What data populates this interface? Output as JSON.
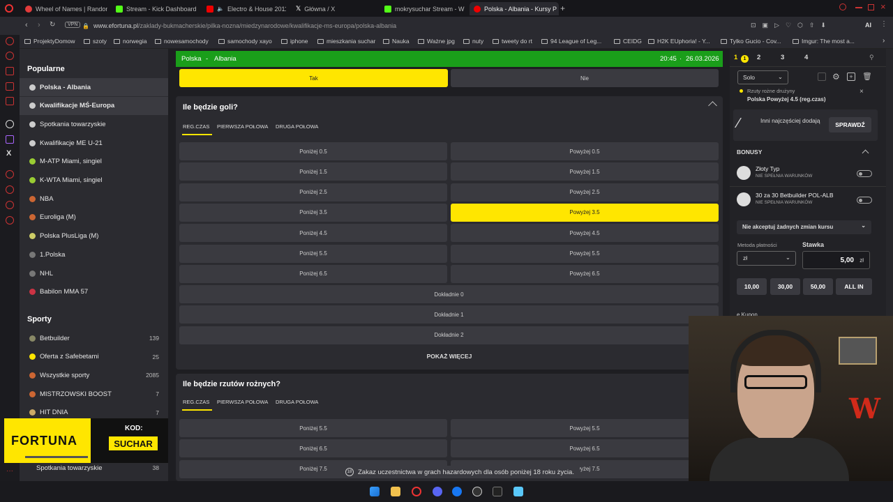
{
  "tabs": [
    {
      "label": "Wheel of Names | Random",
      "color": "#e23b3b"
    },
    {
      "label": "Stream - Kick Dashboard",
      "color": "#53fc18"
    },
    {
      "label": "Electro & House 2011",
      "color": "#e00"
    },
    {
      "label": "Główna / X",
      "color": "#fff"
    },
    {
      "label": "mokrysuchar Stream - W",
      "color": "#53fc18"
    },
    {
      "label": "Polska - Albania - Kursy P",
      "color": "#e00"
    }
  ],
  "address": {
    "vpn": "VPN",
    "host": "www.efortuna.pl",
    "path": "/zaklady-bukmacherskie/pilka-nozna/miedzynarodowe/kwalifikacje-ms-europa/polska-albania",
    "ai": "AI"
  },
  "bookmarks": [
    "ProjektyDomow",
    "szoty",
    "norwegia",
    "nowesamochody",
    "samochody xayo",
    "iphone",
    "mieszkania suchar",
    "Nauka",
    "Ważne jpg",
    "nuty",
    "tweety do rt",
    "94 League of Leg...",
    "CEIDG",
    "H2K EUphoria! - Y...",
    "Tylko Gucio - Cov...",
    "Imgur: The most a..."
  ],
  "sidebar": {
    "popular_title": "Popularne",
    "popular": [
      {
        "label": "Polska - Albania",
        "icon": "#ccc"
      },
      {
        "label": "Kwalifikacje MŚ-Europa",
        "icon": "#ccc"
      },
      {
        "label": "Spotkania towarzyskie",
        "icon": "#ccc"
      },
      {
        "label": "Kwalifikacje ME U-21",
        "icon": "#ccc"
      },
      {
        "label": "M-ATP Miami, singiel",
        "icon": "#9c3"
      },
      {
        "label": "K-WTA Miami, singiel",
        "icon": "#9c3"
      },
      {
        "label": "NBA",
        "icon": "#c63"
      },
      {
        "label": "Euroliga (M)",
        "icon": "#c63"
      },
      {
        "label": "Polska PlusLiga (M)",
        "icon": "#cc6"
      },
      {
        "label": "1.Polska",
        "icon": "#777"
      },
      {
        "label": "NHL",
        "icon": "#777"
      },
      {
        "label": "Babilon MMA 57",
        "icon": "#c34"
      }
    ],
    "sports_title": "Sporty",
    "sports": [
      {
        "label": "Betbuilder",
        "count": "139",
        "icon": "#886"
      },
      {
        "label": "Oferta z Safebetami",
        "count": "25",
        "icon": "#ffe600"
      },
      {
        "label": "Wszystkie sporty",
        "count": "2085",
        "icon": "#c63"
      },
      {
        "label": "MISTRZOWSKI BOOST",
        "count": "7",
        "icon": "#c63"
      },
      {
        "label": "HIT DNIA",
        "count": "7",
        "icon": "#ca6"
      }
    ],
    "bottom": {
      "label": "Spotkania towarzyskie",
      "count": "38"
    }
  },
  "match": {
    "home": "Polska",
    "sep": "-",
    "away": "Albania",
    "time": "20:45",
    "date": "26.03.2026",
    "yes": "Tak",
    "no": "Nie"
  },
  "goals": {
    "title": "Ile będzie goli?",
    "tabs": [
      "REG.CZAS",
      "PIERWSZA POŁOWA",
      "DRUGA POŁOWA"
    ],
    "rows": [
      [
        "Poniżej 0.5",
        "Powyżej 0.5"
      ],
      [
        "Poniżej 1.5",
        "Powyżej 1.5"
      ],
      [
        "Poniżej 2.5",
        "Powyżej 2.5"
      ],
      [
        "Poniżej 3.5",
        "Powyżej 3.5"
      ],
      [
        "Poniżej 4.5",
        "Powyżej 4.5"
      ],
      [
        "Poniżej 5.5",
        "Powyżej 5.5"
      ],
      [
        "Poniżej 6.5",
        "Powyżej 6.5"
      ]
    ],
    "exact": [
      "Dokładnie 0",
      "Dokładnie 1",
      "Dokładnie 2"
    ],
    "more": "POKAŻ WIĘCEJ"
  },
  "corners": {
    "title": "Ile będzie rzutów rożnych?",
    "tabs": [
      "REG.CZAS",
      "PIERWSZA POŁOWA",
      "DRUGA POŁOWA"
    ],
    "rows": [
      [
        "Poniżej 5.5",
        "Powyżej 5.5"
      ],
      [
        "Poniżej 6.5",
        "Powyżej 6.5"
      ],
      [
        "Poniżej 7.5",
        "Powyżej 7.5"
      ]
    ]
  },
  "slip": {
    "tabs": [
      "1",
      "2",
      "3",
      "4"
    ],
    "badge": "1",
    "mode": "Solo",
    "pick_market": "Rzuty rożne drużyny",
    "pick_sel": "Polska Powyżej 4.5 (reg.czas)",
    "others": "Inni najczęściej dodają",
    "check": "SPRAWDŹ",
    "bonus_title": "BONUSY",
    "bonuses": [
      {
        "title": "Złoty Typ",
        "sub": "NIE SPEŁNIA WARUNKÓW"
      },
      {
        "title": "30 za 30 Betbuilder POL-ALB",
        "sub": "NIE SPEŁNIA WARUNKÓW"
      }
    ],
    "odds_change": "Nie akceptuj żadnych zmian kursu",
    "pay_label": "Metoda płatności",
    "pay_value": "zł",
    "stake_label": "Stawka",
    "stake_value": "5,00",
    "stake_cur": "zł",
    "quick": [
      "10,00",
      "30,00",
      "50,00",
      "ALL IN"
    ],
    "coupon": "e Kupon"
  },
  "promo": {
    "brand": "FORTUNA",
    "code_label": "KOD:",
    "code": "SUCHAR"
  },
  "notice": "Zakaz uczestnictwa w grach hazardowych dla osób poniżej 18 roku życia.",
  "age": "18"
}
